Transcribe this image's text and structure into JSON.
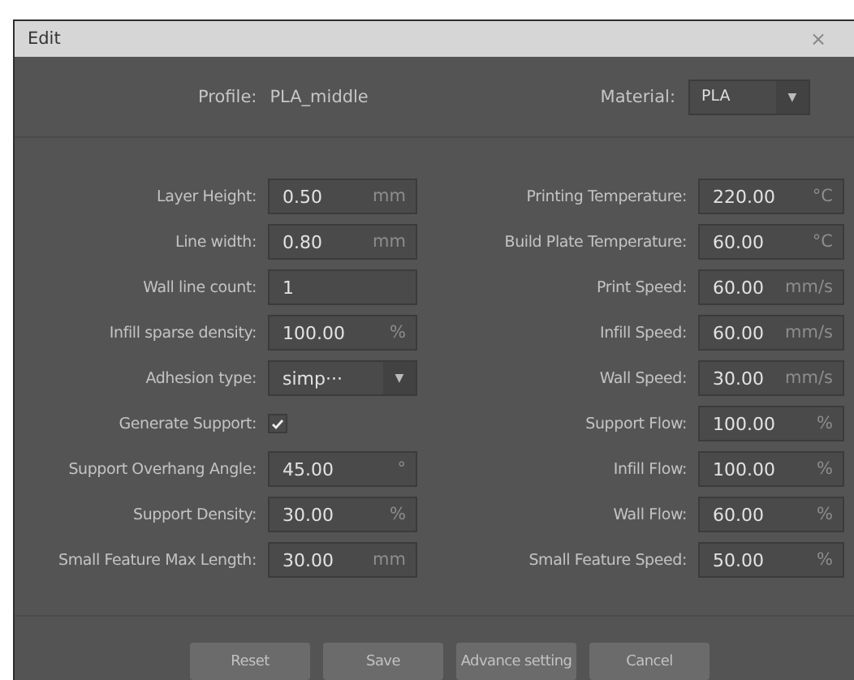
{
  "window": {
    "title": "Edit",
    "close": "×"
  },
  "header": {
    "profile_label": "Profile:",
    "profile_value": "PLA_middle",
    "material_label": "Material:",
    "material_value": "PLA",
    "material_arrow": "▼"
  },
  "left_settings": [
    {
      "label": "Layer Height:",
      "kind": "number",
      "value": "0.50",
      "unit": "mm"
    },
    {
      "label": "Line width:",
      "kind": "number",
      "value": "0.80",
      "unit": "mm"
    },
    {
      "label": "Wall line count:",
      "kind": "text",
      "value": "1"
    },
    {
      "label": "Infill sparse density:",
      "kind": "number",
      "value": "100.00",
      "unit": "%"
    },
    {
      "label": "Adhesion type:",
      "kind": "select",
      "value": "simp···",
      "arrow": "▼"
    },
    {
      "label": "Generate Support:",
      "kind": "checkbox",
      "checked": true
    },
    {
      "label": "Support Overhang Angle:",
      "kind": "number",
      "value": "45.00",
      "unit": "°"
    },
    {
      "label": "Support Density:",
      "kind": "number",
      "value": "30.00",
      "unit": "%"
    },
    {
      "label": "Small Feature Max Length:",
      "kind": "number",
      "value": "30.00",
      "unit": "mm"
    }
  ],
  "right_settings": [
    {
      "label": "Printing Temperature:",
      "kind": "number",
      "value": "220.00",
      "unit": "°C"
    },
    {
      "label": "Build Plate Temperature:",
      "kind": "number",
      "value": "60.00",
      "unit": "°C"
    },
    {
      "label": "Print Speed:",
      "kind": "number",
      "value": "60.00",
      "unit": "mm/s"
    },
    {
      "label": "Infill Speed:",
      "kind": "number",
      "value": "60.00",
      "unit": "mm/s"
    },
    {
      "label": "Wall Speed:",
      "kind": "number",
      "value": "30.00",
      "unit": "mm/s"
    },
    {
      "label": "Support Flow:",
      "kind": "number",
      "value": "100.00",
      "unit": "%"
    },
    {
      "label": "Infill Flow:",
      "kind": "number",
      "value": "100.00",
      "unit": "%"
    },
    {
      "label": "Wall Flow:",
      "kind": "number",
      "value": "60.00",
      "unit": "%"
    },
    {
      "label": "Small Feature Speed:",
      "kind": "number",
      "value": "50.00",
      "unit": "%"
    }
  ],
  "buttons": [
    "Reset",
    "Save",
    "Advance setting",
    "Cancel"
  ]
}
